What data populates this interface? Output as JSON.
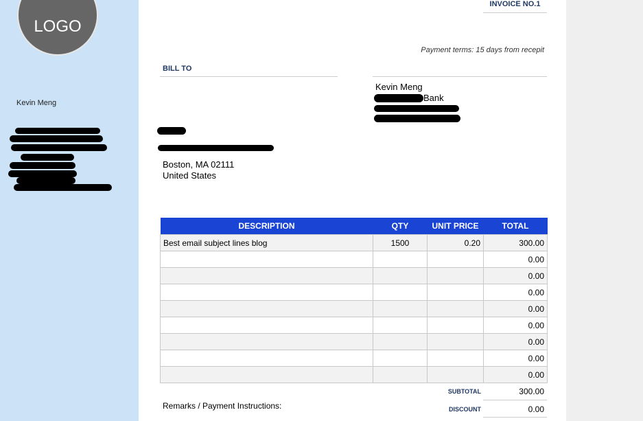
{
  "logo_text": "LOGO",
  "sender": {
    "name": "Kevin Meng"
  },
  "invoice": {
    "number_label": "INVOICE NO.1",
    "payment_terms": "Payment terms: 15 days from recepit"
  },
  "bill_to": {
    "label": "BILL TO",
    "city_line": "Boston, MA 02111",
    "country": "United States"
  },
  "bank": {
    "name": "Kevin Meng",
    "bank_word": "Bank"
  },
  "items_table": {
    "headers": [
      "DESCRIPTION",
      "QTY",
      "UNIT PRICE",
      "TOTAL"
    ],
    "rows": [
      [
        "Best email subject lines blog",
        "1500",
        "0.20",
        "300.00"
      ],
      [
        "",
        "",
        "",
        "0.00"
      ],
      [
        "",
        "",
        "",
        "0.00"
      ],
      [
        "",
        "",
        "",
        "0.00"
      ],
      [
        "",
        "",
        "",
        "0.00"
      ],
      [
        "",
        "",
        "",
        "0.00"
      ],
      [
        "",
        "",
        "",
        "0.00"
      ],
      [
        "",
        "",
        "",
        "0.00"
      ],
      [
        "",
        "",
        "",
        "0.00"
      ]
    ]
  },
  "totals": {
    "subtotal_label": "SUBTOTAL",
    "subtotal": "300.00",
    "discount_label": "DISCOUNT",
    "discount": "0.00"
  },
  "remarks_label": "Remarks / Payment Instructions:",
  "colors": {
    "sidebar": "#cce2f6",
    "header_blue": "#1a44d4",
    "label_navy": "#1f3864",
    "logo_gray": "#666666"
  }
}
